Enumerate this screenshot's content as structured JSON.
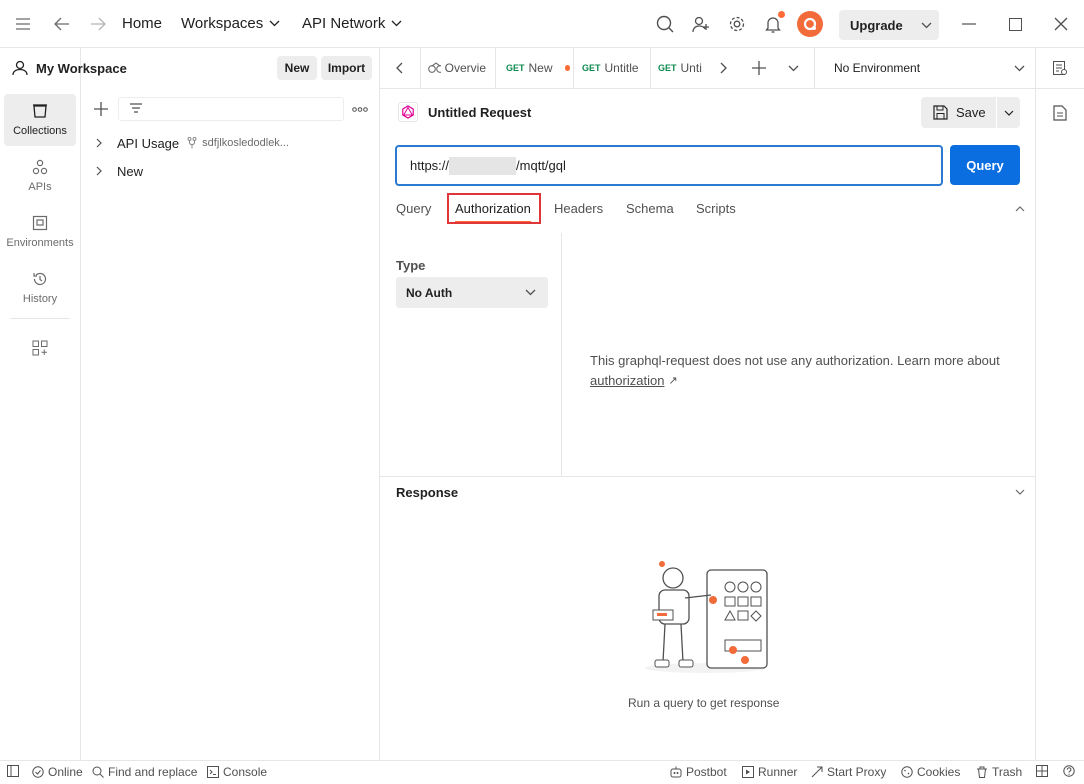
{
  "topbar": {
    "home": "Home",
    "workspaces": "Workspaces",
    "api_network": "API Network",
    "upgrade": "Upgrade"
  },
  "rail": {
    "items": [
      {
        "label": "Collections"
      },
      {
        "label": "APIs"
      },
      {
        "label": "Environments"
      },
      {
        "label": "History"
      }
    ]
  },
  "workspace": {
    "title": "My Workspace",
    "new_label": "New",
    "import_label": "Import",
    "tree": [
      {
        "label": "API Usage",
        "meta": "sdfjlkosledodlek..."
      },
      {
        "label": "New"
      }
    ]
  },
  "tabs": {
    "items": [
      {
        "label": "Overvie"
      },
      {
        "method": "GET",
        "label": "New"
      },
      {
        "method": "GET",
        "label": "Untitle"
      },
      {
        "method": "GET",
        "label": "Unti"
      }
    ],
    "environment": "No Environment"
  },
  "request": {
    "title": "Untitled Request",
    "save_label": "Save",
    "url_prefix": "https://",
    "url_suffix": "/mqtt/gql",
    "query_button": "Query",
    "subtabs": [
      "Query",
      "Authorization",
      "Headers",
      "Schema",
      "Scripts"
    ],
    "type_label": "Type",
    "auth_type": "No Auth",
    "auth_message": "This graphql-request does not use any authorization. Learn more about",
    "auth_link": "authorization",
    "auth_link_arrow": "↗"
  },
  "response": {
    "title": "Response",
    "empty_message": "Run a query to get response"
  },
  "statusbar": {
    "online": "Online",
    "find_replace": "Find and replace",
    "console": "Console",
    "postbot": "Postbot",
    "runner": "Runner",
    "start_proxy": "Start Proxy",
    "cookies": "Cookies",
    "trash": "Trash"
  },
  "colors": {
    "accent": "#0b6ee0",
    "highlight_box": "#e0363a",
    "brand": "#ff6c37"
  }
}
